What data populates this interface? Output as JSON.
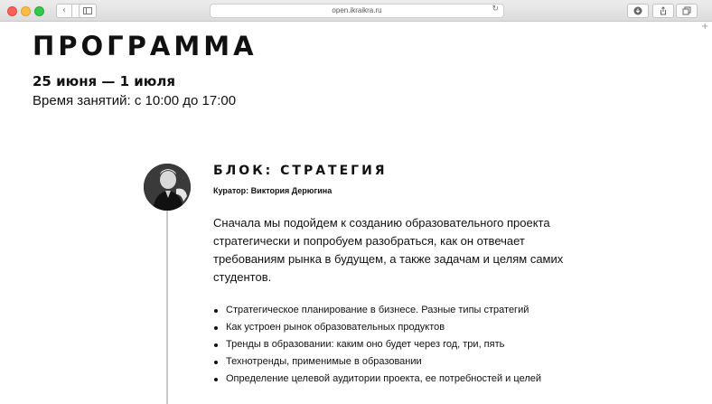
{
  "browser": {
    "url": "open.ikraikra.ru",
    "icons": {
      "back": "chevron-left-icon",
      "forward": "chevron-right-icon",
      "sidebar": "sidebar-icon",
      "reload": "reload-icon",
      "downloads": "download-icon",
      "share": "share-icon",
      "tabs": "tabs-icon",
      "new_tab": "plus-icon"
    }
  },
  "header": {
    "title": "ПРОГРАММА",
    "dates": "25 июня — 1 июля",
    "time": "Время занятий: с 10:00 до 17:00"
  },
  "block": {
    "title": "БЛОК: СТРАТЕГИЯ",
    "curator": "Куратор: Виктория Дерюгина",
    "description": "Сначала мы подойдем к созданию образовательного проекта стратегически и попробуем разобраться, как он отвечает требованиям рынка в будущем, а также задачам и целям самих студентов.",
    "topics": [
      "Стратегическое планирование в бизнесе. Разные типы стратегий",
      "Как устроен рынок образовательных продуктов",
      "Тренды в образовании: каким оно будет через год, три, пять",
      "Технотренды, применимые в образовании",
      "Определение целевой аудитории проекта, ее потребностей и целей"
    ]
  },
  "colors": {
    "text": "#111111",
    "timeline": "#c9c9c9",
    "chrome": "#e4e4e4"
  }
}
